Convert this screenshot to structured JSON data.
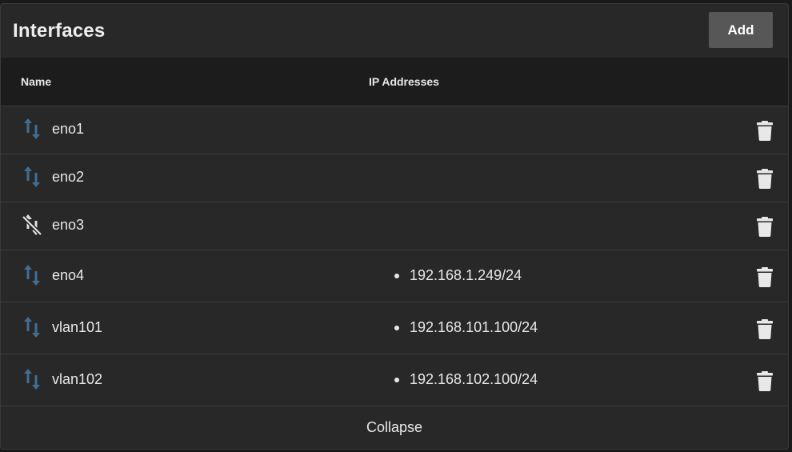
{
  "card": {
    "title": "Interfaces",
    "add_label": "Add"
  },
  "table": {
    "headers": {
      "name": "Name",
      "ip": "IP Addresses"
    },
    "rows": [
      {
        "name": "eno1",
        "link_icon": "link-up-down-arrows-icon",
        "ip": ""
      },
      {
        "name": "eno2",
        "link_icon": "link-up-down-arrows-icon",
        "ip": ""
      },
      {
        "name": "eno3",
        "link_icon": "link-down-crossed-arrows-icon",
        "ip": ""
      },
      {
        "name": "eno4",
        "link_icon": "link-up-down-arrows-icon",
        "ip": "192.168.1.249/24"
      },
      {
        "name": "vlan101",
        "link_icon": "link-up-down-arrows-icon",
        "ip": "192.168.101.100/24"
      },
      {
        "name": "vlan102",
        "link_icon": "link-up-down-arrows-icon",
        "ip": "192.168.102.100/24"
      }
    ],
    "delete_icon": "trash-icon"
  },
  "footer": {
    "collapse_label": "Collapse"
  },
  "colors": {
    "background": "#1a1a1a",
    "card": "#282828",
    "header_band": "#1c1c1c",
    "add_button": "#575757",
    "link_up_icon": "#3e6e94",
    "link_down_icon": "#e0e0e0",
    "text": "#e8e8e8"
  }
}
